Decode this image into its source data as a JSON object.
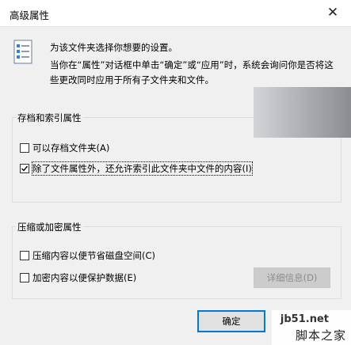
{
  "window": {
    "title": "高级属性",
    "close_icon": "close-icon"
  },
  "intro": {
    "line1": "为该文件夹选择你想要的设置。",
    "line2": "当你在“属性”对话框中单击“确定”或“应用”时，系统会询问你是否将这",
    "line3": "些更改同时应用于所有子文件夹和文件。"
  },
  "archive_group": {
    "label": "存档和索引属性",
    "items": [
      {
        "label": "可以存档文件夹(A)",
        "checked": false
      },
      {
        "label": "除了文件属性外，还允许索引此文件夹中文件的内容(I)",
        "checked": true
      }
    ]
  },
  "compress_group": {
    "label": "压缩或加密属性",
    "items": [
      {
        "label": "压缩内容以便节省磁盘空间(C)",
        "checked": false
      },
      {
        "label": "加密内容以便保护数据(E)",
        "checked": false
      }
    ],
    "details_button": "详细信息(D)"
  },
  "buttons": {
    "ok": "确定"
  },
  "watermark": {
    "site": "jb51.net",
    "name": "脚本之家"
  }
}
